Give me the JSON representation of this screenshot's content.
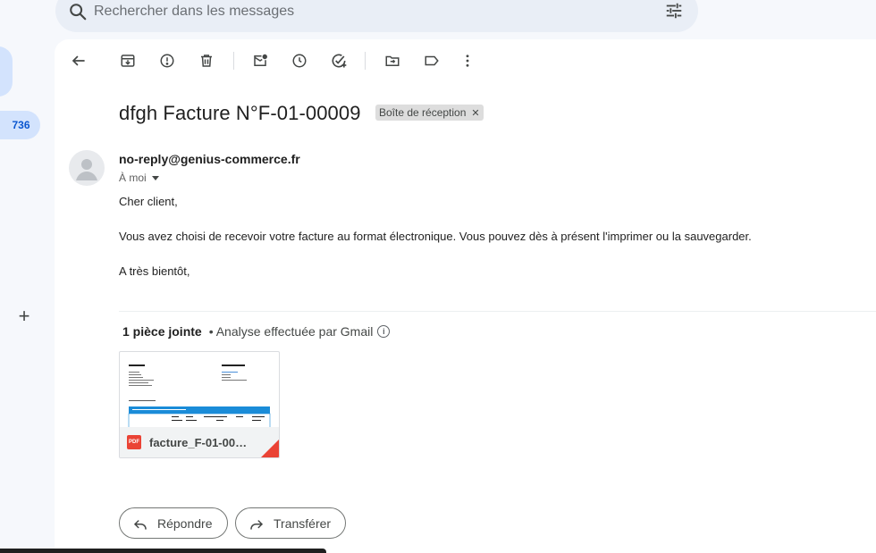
{
  "search": {
    "placeholder": "Rechercher dans les messages"
  },
  "rail": {
    "inbox_count": "736"
  },
  "toolbar": {
    "buttons": [
      "back",
      "archive",
      "report-spam",
      "delete",
      "mark-unread",
      "snooze",
      "add-to-tasks",
      "move-to",
      "labels",
      "more"
    ]
  },
  "email": {
    "subject": "dfgh Facture N°F-01-00009",
    "label": "Boîte de réception",
    "sender": "no-reply@genius-commerce.fr",
    "to": "À moi",
    "body": [
      "Cher client,",
      "Vous avez choisi de recevoir votre facture au format électronique. Vous pouvez dès à présent l'imprimer ou la sauvegarder.",
      "A très bientôt,"
    ]
  },
  "attachments": {
    "count_label": "1 pièce jointe",
    "scan_label": "• Analyse effectuée par Gmail",
    "file": {
      "name": "facture_F-01-00…",
      "type": "PDF"
    }
  },
  "actions": {
    "reply": "Répondre",
    "forward": "Transférer"
  }
}
